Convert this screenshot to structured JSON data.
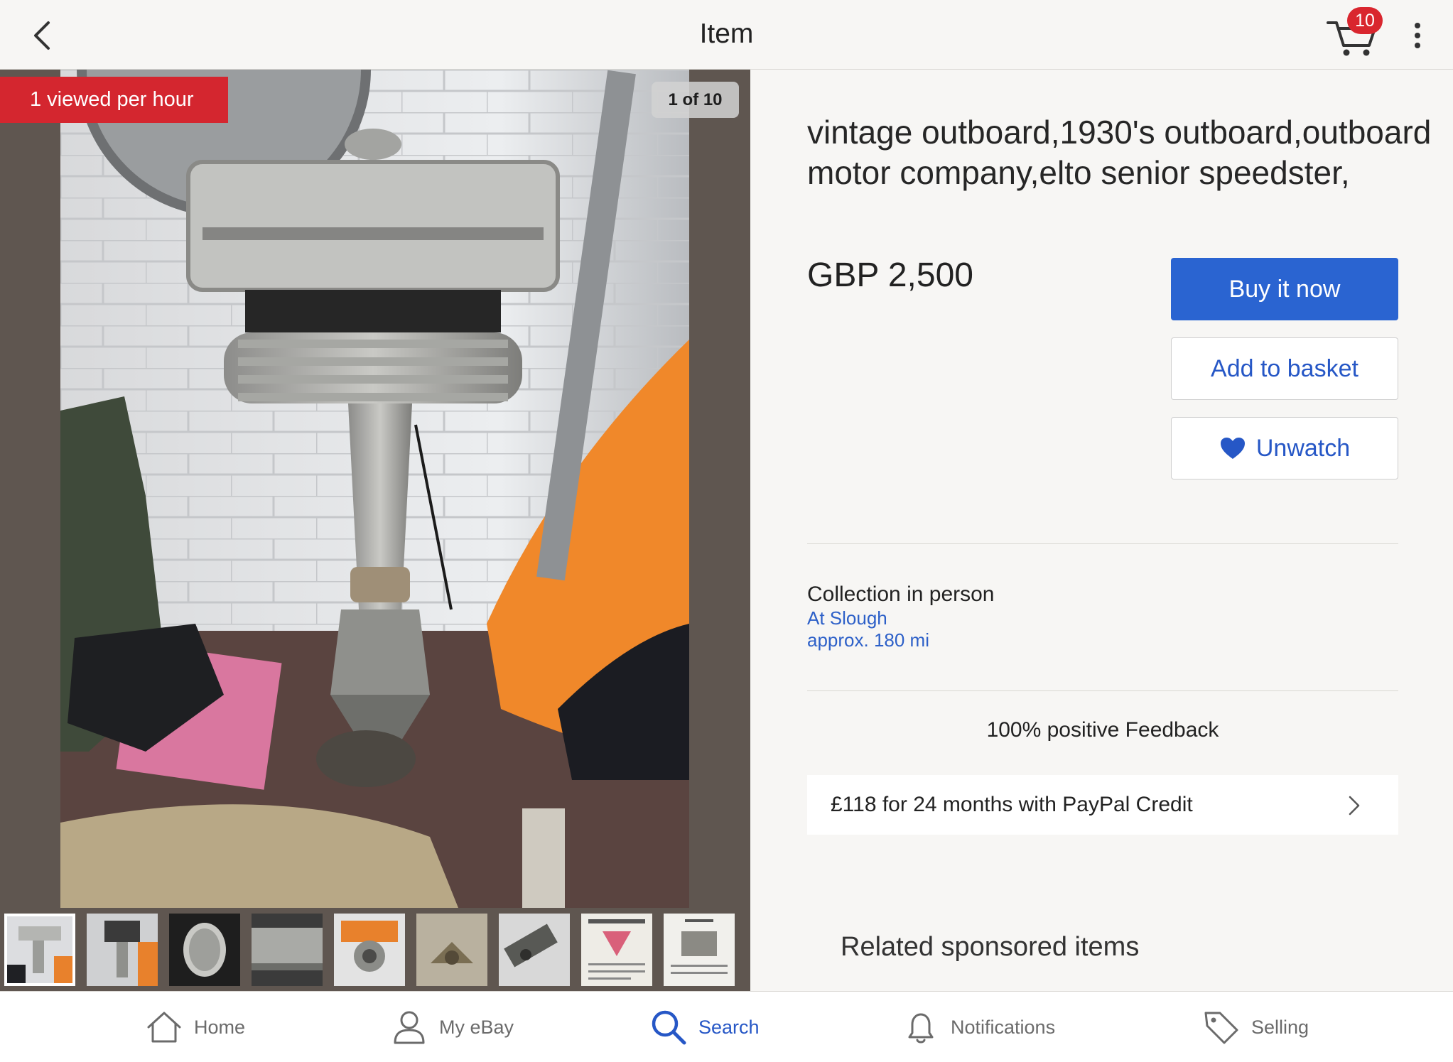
{
  "header": {
    "title": "Item",
    "cart_count": "10"
  },
  "gallery": {
    "viewed_badge": "1 viewed per hour",
    "counter": "1 of 10",
    "thumbnail_count": 9
  },
  "item": {
    "title": "vintage outboard,1930's outboard,outboard motor company,elto senior speedster,",
    "price": "GBP 2,500"
  },
  "actions": {
    "buy_now": "Buy it now",
    "add_to_basket": "Add to basket",
    "unwatch": "Unwatch"
  },
  "delivery": {
    "label": "Collection in person",
    "location": "At Slough",
    "distance": "approx. 180 mi"
  },
  "seller": {
    "feedback": "100% positive Feedback"
  },
  "credit": {
    "text": "£118 for 24 months with PayPal Credit"
  },
  "related": {
    "title": "Related sponsored items"
  },
  "bottom_nav": [
    {
      "label": "Home",
      "icon": "home-icon",
      "active": false
    },
    {
      "label": "My eBay",
      "icon": "person-icon",
      "active": false
    },
    {
      "label": "Search",
      "icon": "search-icon",
      "active": true
    },
    {
      "label": "Notifications",
      "icon": "bell-icon",
      "active": false
    },
    {
      "label": "Selling",
      "icon": "tag-icon",
      "active": false
    }
  ],
  "colors": {
    "accent_blue": "#2a64d1",
    "badge_red": "#d4262f",
    "background": "#f7f6f4"
  }
}
